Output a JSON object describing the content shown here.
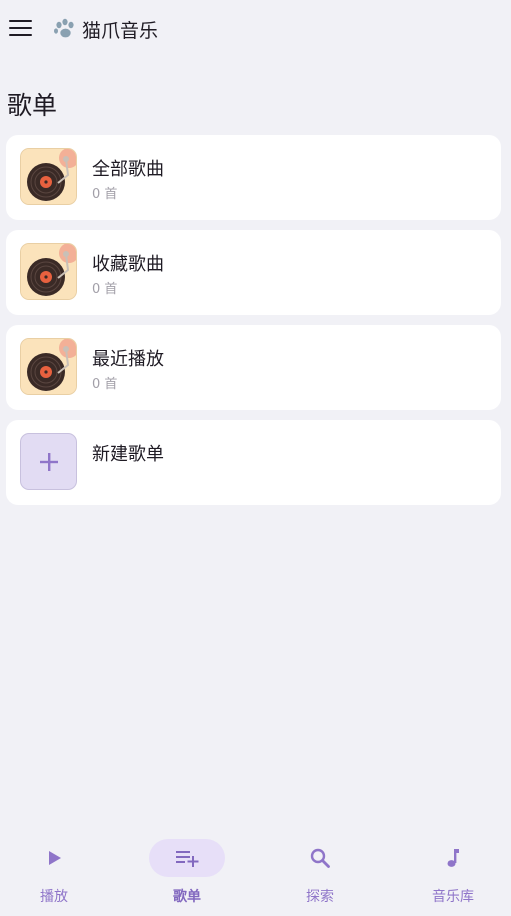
{
  "app": {
    "title": "猫爪音乐",
    "logo_icon": "paw-icon"
  },
  "section": {
    "title": "歌单"
  },
  "playlists": [
    {
      "name": "全部歌曲",
      "count": "0 首"
    },
    {
      "name": "收藏歌曲",
      "count": "0 首"
    },
    {
      "name": "最近播放",
      "count": "0 首"
    }
  ],
  "new_playlist": {
    "label": "新建歌单"
  },
  "nav": {
    "items": [
      {
        "label": "播放",
        "icon": "play-icon"
      },
      {
        "label": "歌单",
        "icon": "playlist-add-icon",
        "active": true
      },
      {
        "label": "探索",
        "icon": "search-icon"
      },
      {
        "label": "音乐库",
        "icon": "music-note-icon"
      }
    ]
  },
  "colors": {
    "background": "#f1f1f6",
    "card": "#ffffff",
    "accent": "#8f75c9",
    "accent_pill": "#e7dff8",
    "add_tile": "#e2dcf3"
  }
}
